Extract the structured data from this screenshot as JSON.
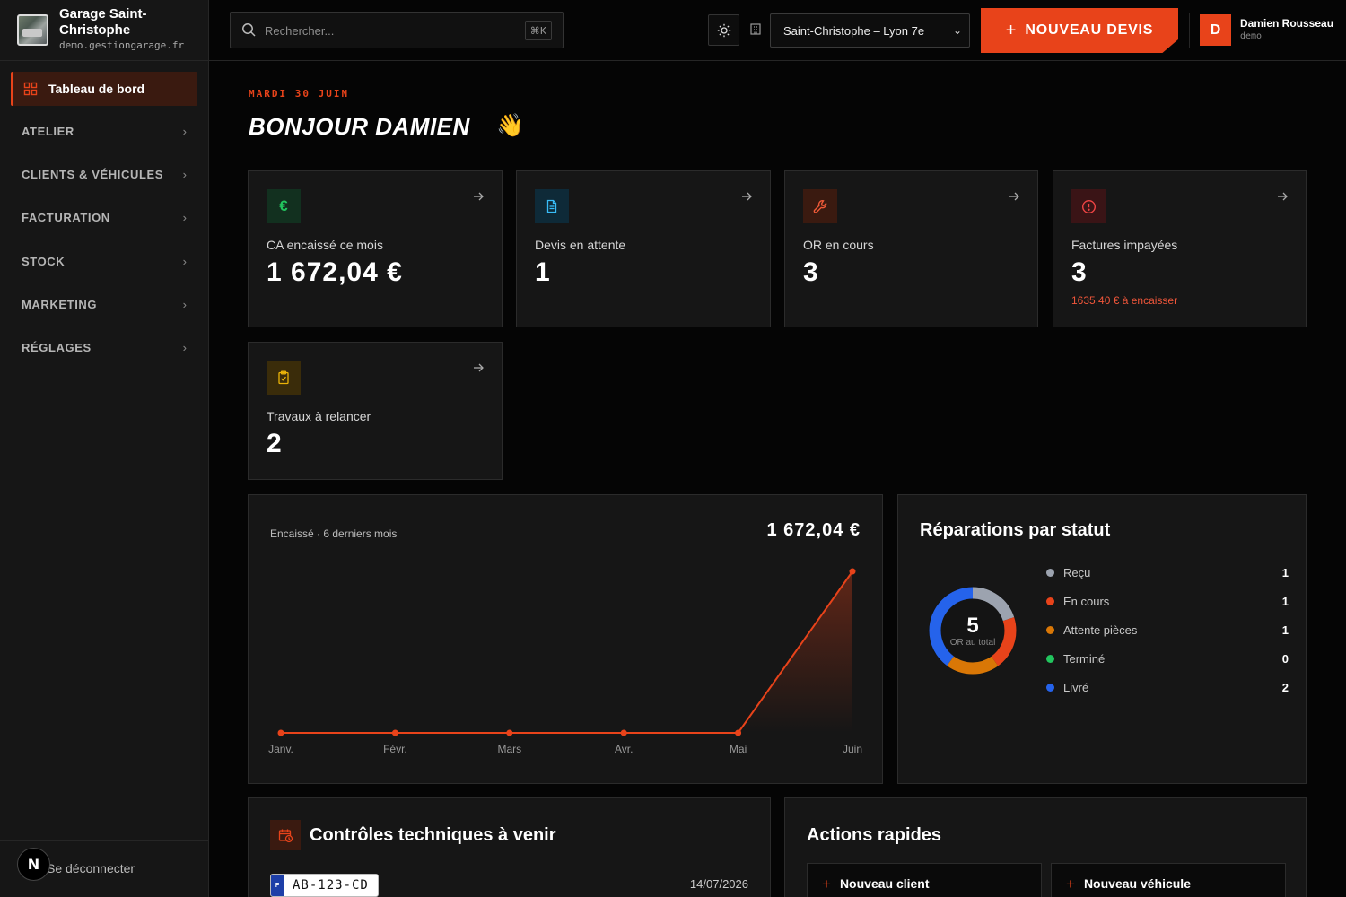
{
  "brand": {
    "name": "Garage Saint-Christophe",
    "domain": "demo.gestiongarage.fr"
  },
  "sidebar": {
    "active": {
      "label": "Tableau de bord",
      "icon": "dashboard-grid-icon"
    },
    "groups": [
      {
        "label": "ATELIER"
      },
      {
        "label": "CLIENTS & VÉHICULES"
      },
      {
        "label": "FACTURATION"
      },
      {
        "label": "STOCK"
      },
      {
        "label": "MARKETING"
      },
      {
        "label": "RÉGLAGES"
      }
    ],
    "logout_label": "Se déconnecter",
    "badge": "N"
  },
  "topbar": {
    "search_placeholder": "Rechercher...",
    "shortcut": "⌘K",
    "site_selected": "Saint-Christophe – Lyon 7e",
    "new_quote_label": "NOUVEAU DEVIS",
    "user": {
      "initial": "D",
      "name": "Damien Rousseau",
      "role": "demo"
    }
  },
  "header": {
    "date": "MARDI 30 JUIN",
    "greeting": "BONJOUR DAMIEN",
    "emoji": "👋"
  },
  "kpis": [
    {
      "label": "CA encaissé ce mois",
      "value": "1 672,04 €",
      "icon": "euro-icon",
      "color": "#22c55e"
    },
    {
      "label": "Devis en attente",
      "value": "1",
      "icon": "document-icon",
      "color": "#38bdf8"
    },
    {
      "label": "OR en cours",
      "value": "3",
      "icon": "wrench-icon",
      "color": "#f05a38"
    },
    {
      "label": "Factures impayées",
      "value": "3",
      "sub": "1635,40 € à encaisser",
      "icon": "alert-circle-icon",
      "color": "#ef4444"
    },
    {
      "label": "Travaux à relancer",
      "value": "2",
      "icon": "clipboard-check-icon",
      "color": "#eab308"
    }
  ],
  "revenue_chart": {
    "title": "Encaissé · 6 derniers mois",
    "total": "1 672,04 €"
  },
  "status_panel": {
    "title": "Réparations par statut",
    "total": "5",
    "total_label": "OR au total"
  },
  "controls": {
    "title": "Contrôles techniques à venir",
    "items": [
      {
        "plate": "AB-123-CD",
        "country": "F",
        "date": "14/07/2026"
      }
    ]
  },
  "quick_actions": {
    "title": "Actions rapides",
    "items": [
      {
        "label": "Nouveau client"
      },
      {
        "label": "Nouveau véhicule"
      }
    ]
  },
  "colors": {
    "accent": "#e8431a",
    "bg": "#050505",
    "panel": "#161616"
  },
  "chart_data": [
    {
      "type": "area",
      "title": "Encaissé · 6 derniers mois",
      "categories": [
        "Janv.",
        "Févr.",
        "Mars",
        "Avr.",
        "Mai",
        "Juin"
      ],
      "values": [
        0,
        0,
        0,
        0,
        0,
        1672.04
      ],
      "unit": "€",
      "grid": false
    },
    {
      "type": "pie",
      "title": "Réparations par statut",
      "categories": [
        "Reçu",
        "En cours",
        "Attente pièces",
        "Terminé",
        "Livré"
      ],
      "values": [
        1,
        1,
        1,
        0,
        2
      ],
      "colors": [
        "#9ca3af",
        "#e8431a",
        "#d97706",
        "#22c55e",
        "#2563eb"
      ],
      "legend": "right"
    }
  ]
}
